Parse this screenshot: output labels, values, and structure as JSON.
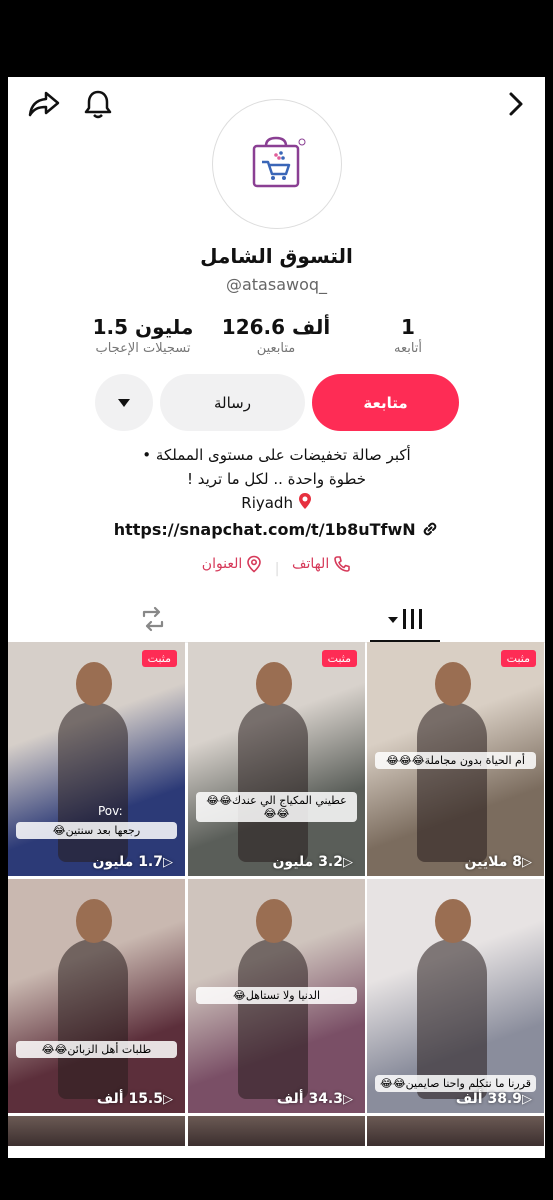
{
  "profile": {
    "display_name": "التسوق الشامل",
    "handle": "@atasawoq_"
  },
  "stats": {
    "following_count": "1",
    "following_label": "أتابعه",
    "followers_count": "126.6 ألف",
    "followers_label": "متابعين",
    "likes_count": "1.5 مليون",
    "likes_label": "تسجيلات الإعجاب"
  },
  "actions": {
    "follow_label": "متابعة",
    "message_label": "رسالة"
  },
  "bio": {
    "line1": "أكبر صالة تخفيضات على مستوى المملكة •",
    "line2": "خطوة واحدة .. لكل ما تريد !",
    "location": "Riyadh",
    "link": "https://snapchat.com/t/1b8uTfwN"
  },
  "contacts": {
    "phone_label": "الهاتف",
    "address_label": "العنوان"
  },
  "videos": [
    {
      "pinned": "مثبت",
      "caption": "أم الحياة بدون مجاملة😂😂😂",
      "views": "8 ملايين",
      "bg1": "#7b6c5e",
      "bg2": "#d9cfc4"
    },
    {
      "pinned": "مثبت",
      "caption": "عطيني المكياج الي عندك😂😂😂😂",
      "views": "3.2 مليون",
      "bg1": "#5a5e59",
      "bg2": "#d8d2cc"
    },
    {
      "pinned": "مثبت",
      "caption": "رجعها بعد سنتين😂",
      "caption_pre": "Pov:",
      "views": "1.7 مليون",
      "bg1": "#2c3a77",
      "bg2": "#d6cfc9"
    },
    {
      "pinned": "",
      "caption": "قررنا ما نتكلم واحنا صايمين😂😂",
      "views": "38.9 ألف",
      "bg1": "#8a8d9c",
      "bg2": "#e7e3e3"
    },
    {
      "pinned": "",
      "caption": "الدنيا ولا تستاهل😂",
      "views": "34.3 ألف",
      "bg1": "#7a4f66",
      "bg2": "#cfc4bd"
    },
    {
      "pinned": "",
      "caption": "طلبات أهل الزبائن😂😂",
      "views": "15.5 ألف",
      "bg1": "#5c2f3b",
      "bg2": "#c9b8b0"
    }
  ],
  "colors": {
    "accent": "#fe2c55",
    "link": "#d63a5a"
  },
  "icons": {
    "back": "chevron-right-icon",
    "share": "share-icon",
    "bell": "bell-icon"
  }
}
